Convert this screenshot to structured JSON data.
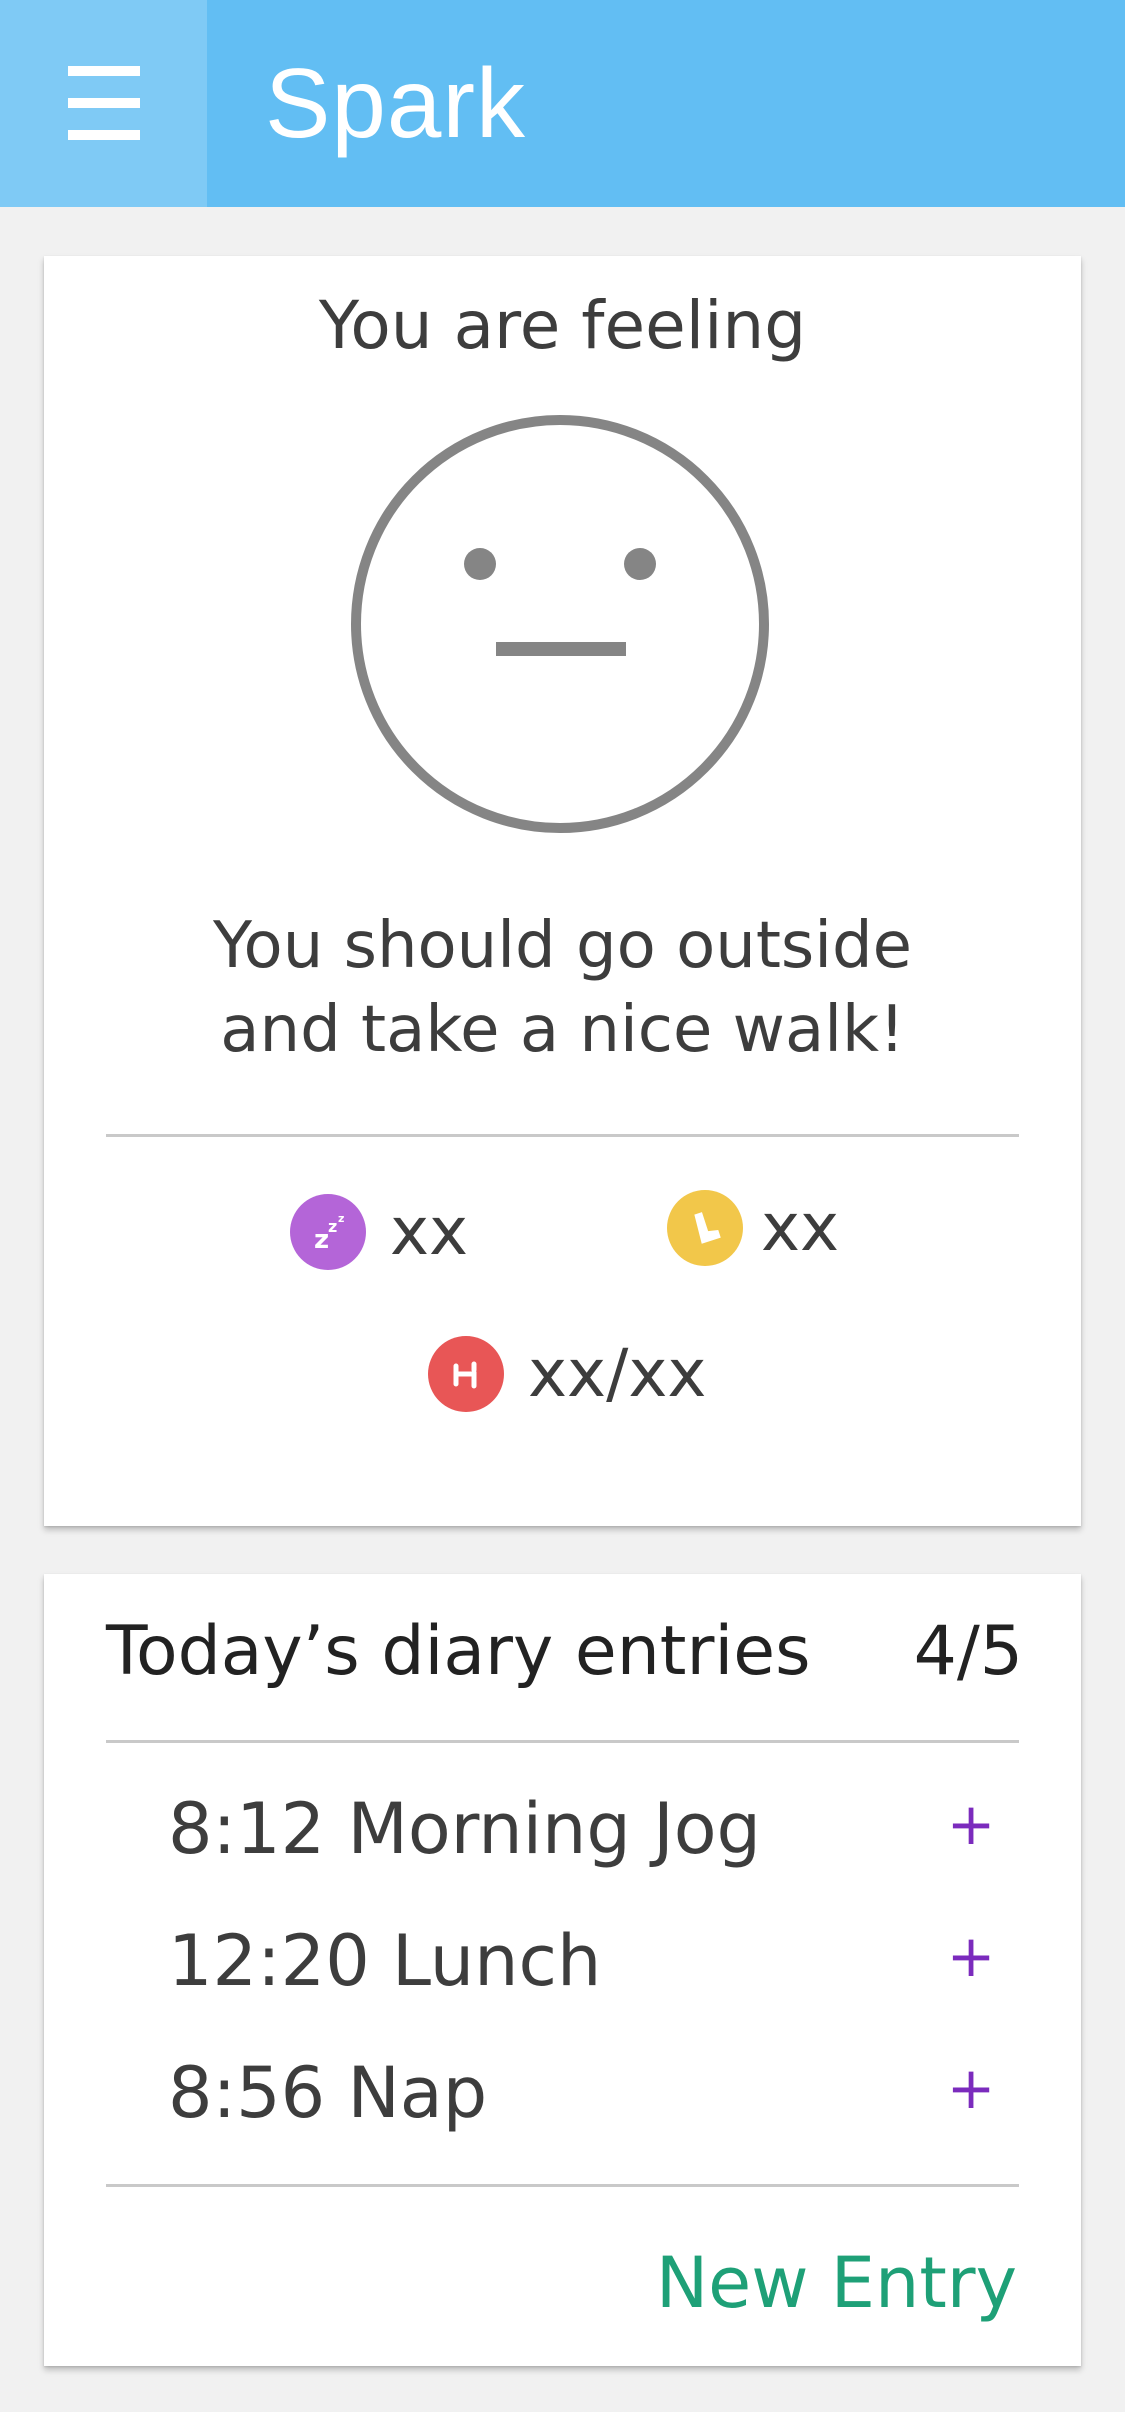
{
  "app": {
    "title": "Spark"
  },
  "mood": {
    "heading": "You are feeling",
    "advice_line1": "You should go outside",
    "advice_line2": "and take a nice walk!",
    "stats": [
      {
        "icon": "sleep-icon",
        "color": "#b465d8",
        "value": "xx"
      },
      {
        "icon": "steps-icon",
        "color": "#f2c74a",
        "value": "xx"
      },
      {
        "icon": "heart-rate-icon",
        "color": "#e85656",
        "value": "xx/xx"
      }
    ]
  },
  "diary": {
    "title": "Today’s diary entries",
    "count": "4/5",
    "entries": [
      {
        "label": "8:12 Morning Jog",
        "action": "+"
      },
      {
        "label": "12:20 Lunch",
        "action": "+"
      },
      {
        "label": "8:56 Nap",
        "action": "+"
      }
    ],
    "new_entry": "New Entry"
  },
  "colors": {
    "app_bar": "#62bef3",
    "menu_bg": "#7fcaf5",
    "accent_plus": "#7b2bbd",
    "new_entry": "#1ea077"
  }
}
